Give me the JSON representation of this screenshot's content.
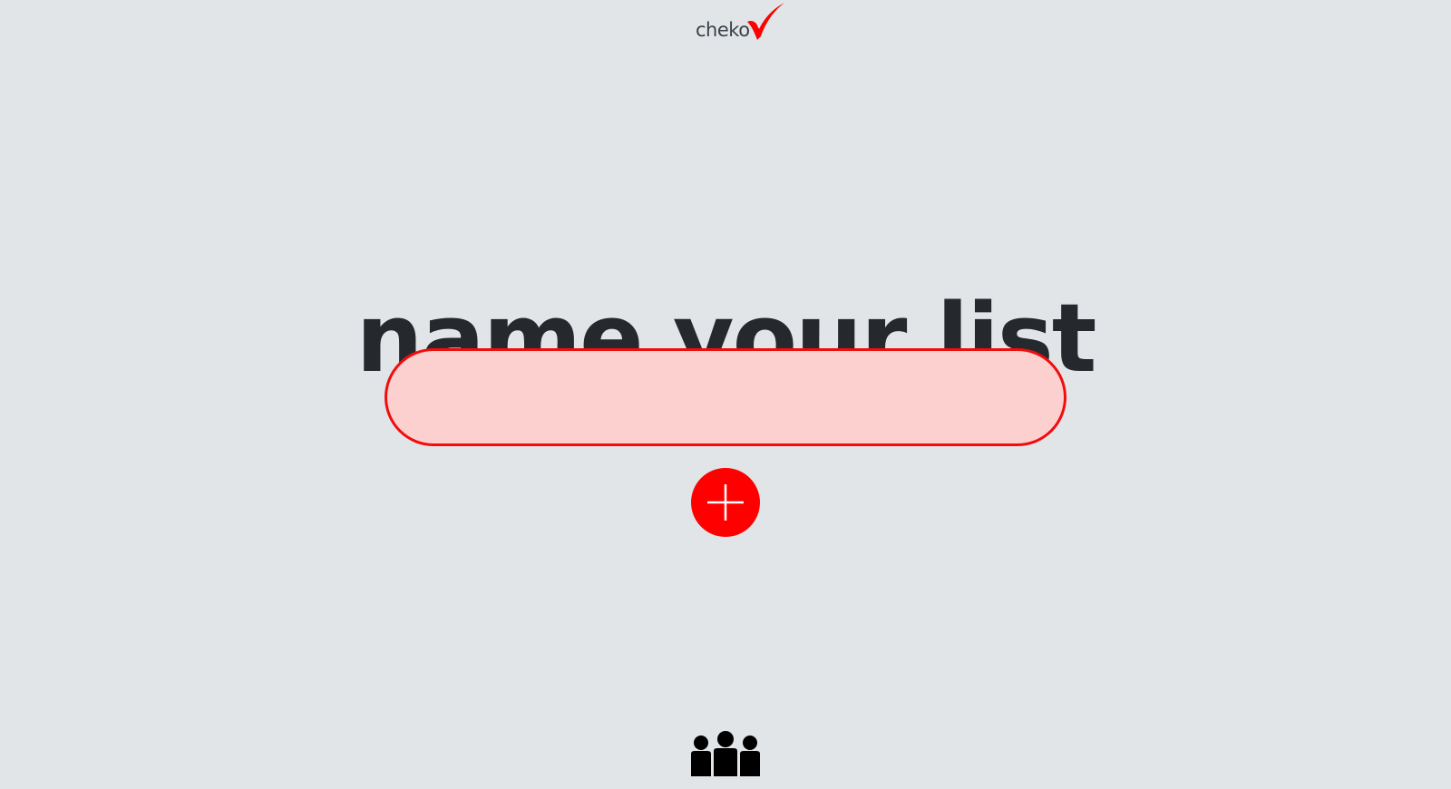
{
  "app": {
    "logo_text": "cheko",
    "accent_color": "#ff0000",
    "background_color": "#e1e5e8",
    "text_color": "#25292d"
  },
  "main": {
    "title": "name your list",
    "name_input": {
      "value": "",
      "placeholder": "",
      "state": "invalid"
    },
    "add_button": {
      "icon": "plus-icon"
    }
  },
  "footer": {
    "users_button": {
      "icon": "group-icon"
    }
  }
}
